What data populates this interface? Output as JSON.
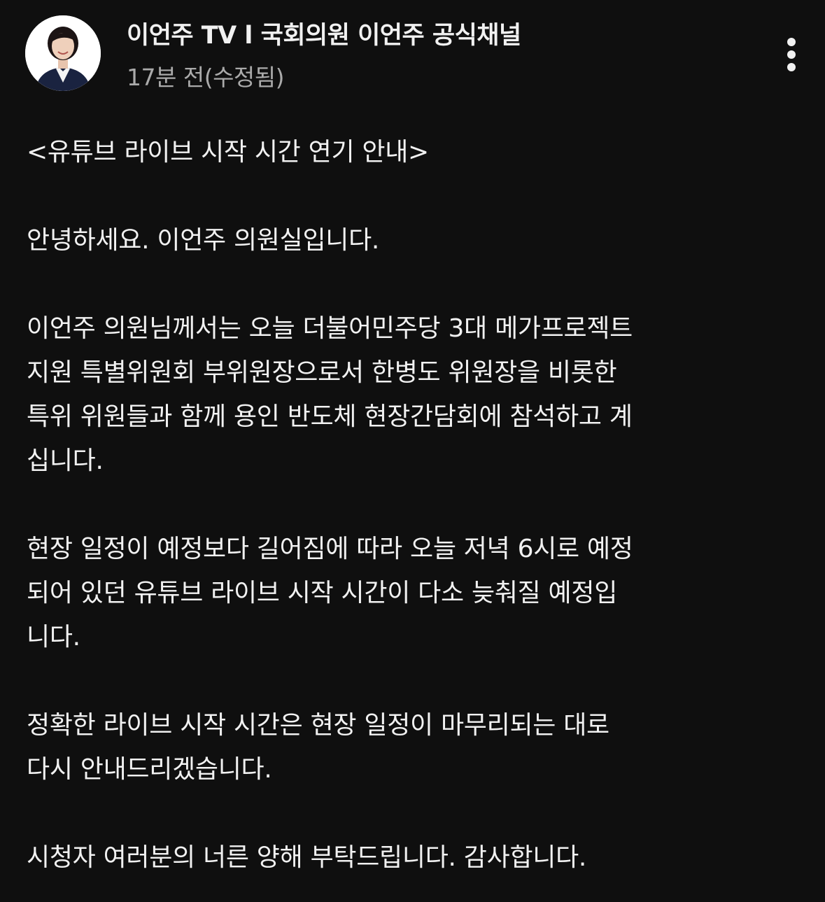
{
  "post": {
    "channel_name": "이언주 TV l 국회의원 이언주 공식채널",
    "timestamp": "17분 전(수정됨)",
    "avatar_icon": "profile-photo",
    "menu_icon": "more-vert-icon",
    "lines": [
      "<유튜브 라이브 시작 시간 연기 안내>",
      "",
      "안녕하세요. 이언주 의원실입니다.",
      "",
      "이언주 의원님께서는 오늘 더불어민주당 3대 메가프로젝트",
      "지원 특별위원회 부위원장으로서 한병도 위원장을 비롯한",
      "특위 위원들과 함께 용인 반도체 현장간담회에 참석하고 계",
      "십니다.",
      "",
      "현장 일정이 예정보다 길어짐에 따라 오늘 저녁 6시로 예정",
      "되어 있던 유튜브 라이브 시작 시간이 다소 늦춰질 예정입",
      "니다.",
      "",
      "정확한 라이브 시작 시간은 현장 일정이 마무리되는 대로",
      "다시 안내드리겠습니다.",
      "",
      "시청자 여러분의 너른 양해 부탁드립니다. 감사합니다."
    ]
  },
  "colors": {
    "background": "#0f0f0f",
    "primary_text": "#f1f1f1",
    "secondary_text": "#aaaaaa"
  }
}
